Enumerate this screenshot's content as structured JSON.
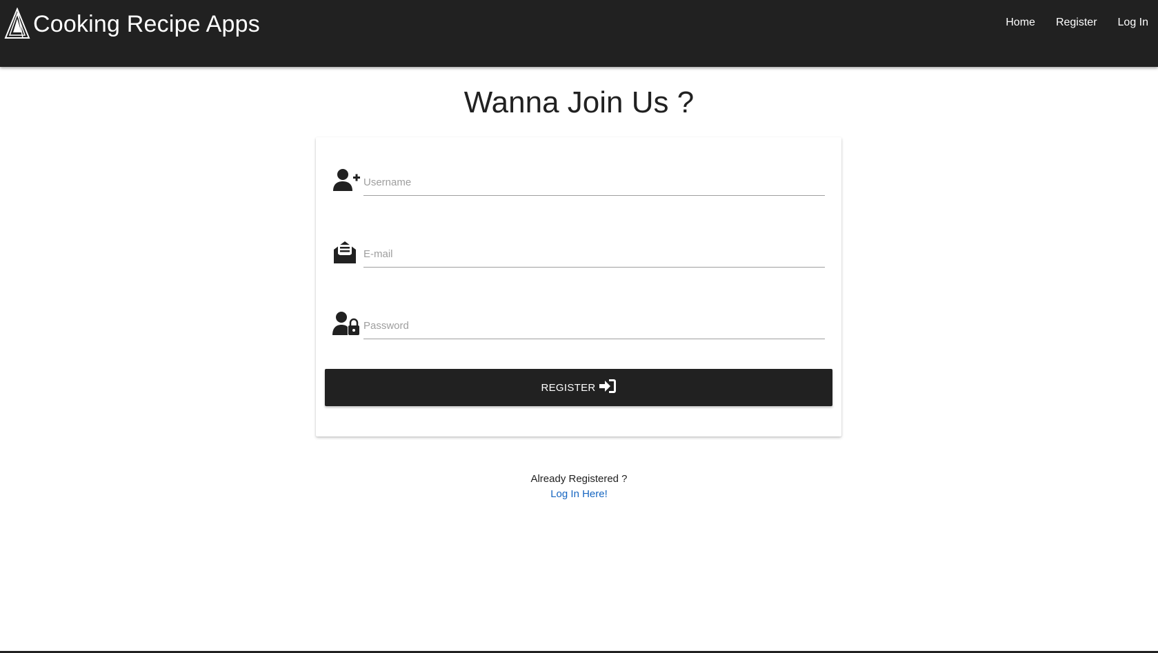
{
  "navbar": {
    "brand_title": "Cooking Recipe Apps",
    "logo_icon": "triangle-logo-icon",
    "links": [
      {
        "label": "Home"
      },
      {
        "label": "Register"
      },
      {
        "label": "Log In"
      }
    ],
    "background": "#212121"
  },
  "page": {
    "title": "Wanna Join Us ?"
  },
  "form": {
    "fields": [
      {
        "icon": "user-plus-icon",
        "placeholder": "Username",
        "value": ""
      },
      {
        "icon": "envelope-open-text-icon",
        "placeholder": "E-mail",
        "value": ""
      },
      {
        "icon": "user-lock-icon",
        "placeholder": "Password",
        "value": ""
      }
    ],
    "submit": {
      "label": "REGISTER",
      "icon": "sign-in-icon"
    }
  },
  "footer_prompt": {
    "text": "Already Registered ?",
    "link_label": "Log In Here!"
  },
  "colors": {
    "dark": "#212121",
    "link": "#1565c0",
    "underline": "#9e9e9e"
  }
}
